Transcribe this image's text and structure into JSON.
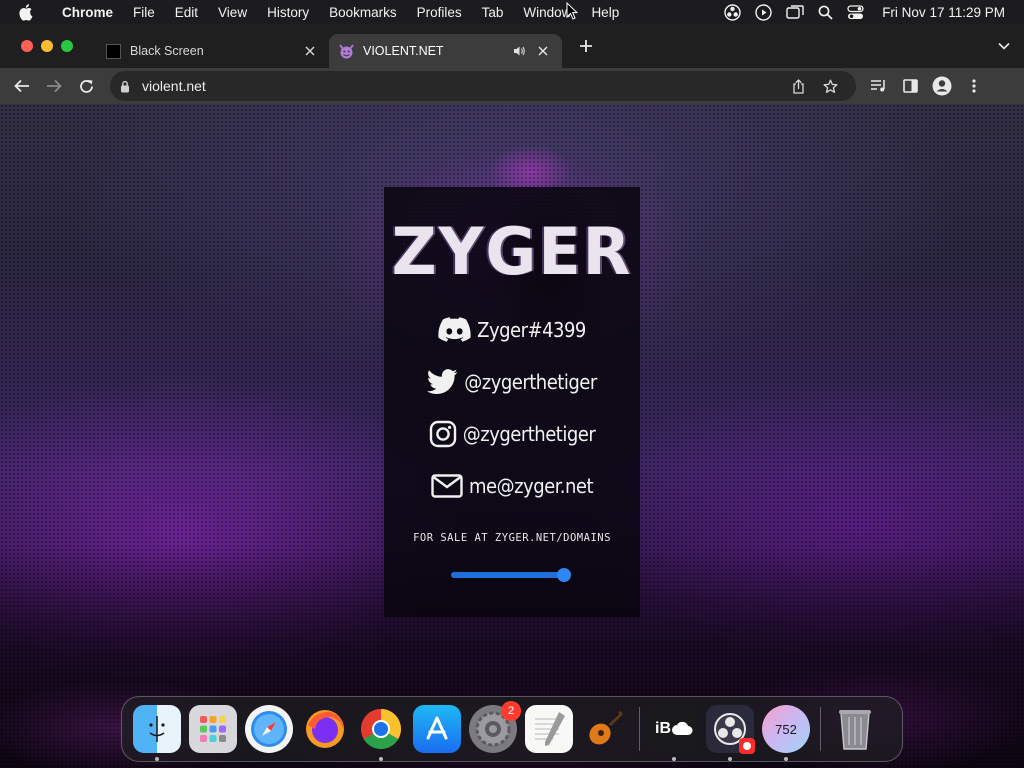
{
  "menubar": {
    "app_name": "Chrome",
    "items": [
      "File",
      "Edit",
      "View",
      "History",
      "Bookmarks",
      "Profiles",
      "Tab",
      "Window",
      "Help"
    ],
    "clock": "Fri Nov 17  11:29 PM"
  },
  "tabs": [
    {
      "title": "Black Screen",
      "active": false
    },
    {
      "title": "VIOLENT.NET",
      "active": true
    }
  ],
  "toolbar": {
    "url": "violent.net"
  },
  "page": {
    "brand": "ZYGER",
    "socials": [
      {
        "icon": "discord-icon",
        "text": "Zyger#4399"
      },
      {
        "icon": "twitter-icon",
        "text": "@zygerthetiger"
      },
      {
        "icon": "instagram-icon",
        "text": "@zygerthetiger"
      },
      {
        "icon": "mail-icon",
        "text": "me@zyger.net"
      }
    ],
    "sale_text": "FOR SALE AT ZYGER.NET/DOMAINS",
    "volume_level": 0.95,
    "accent_color": "#2f86f0"
  },
  "dock": {
    "apps": [
      "Finder",
      "Launchpad",
      "Safari",
      "Firefox",
      "Chrome",
      "App Store",
      "System Settings",
      "TextEdit",
      "GarageBand",
      "iBoostUp",
      "OBS",
      "Counter",
      "Trash"
    ],
    "system_settings_badge": "2",
    "counter_value": "752",
    "ib_label": "iB"
  }
}
